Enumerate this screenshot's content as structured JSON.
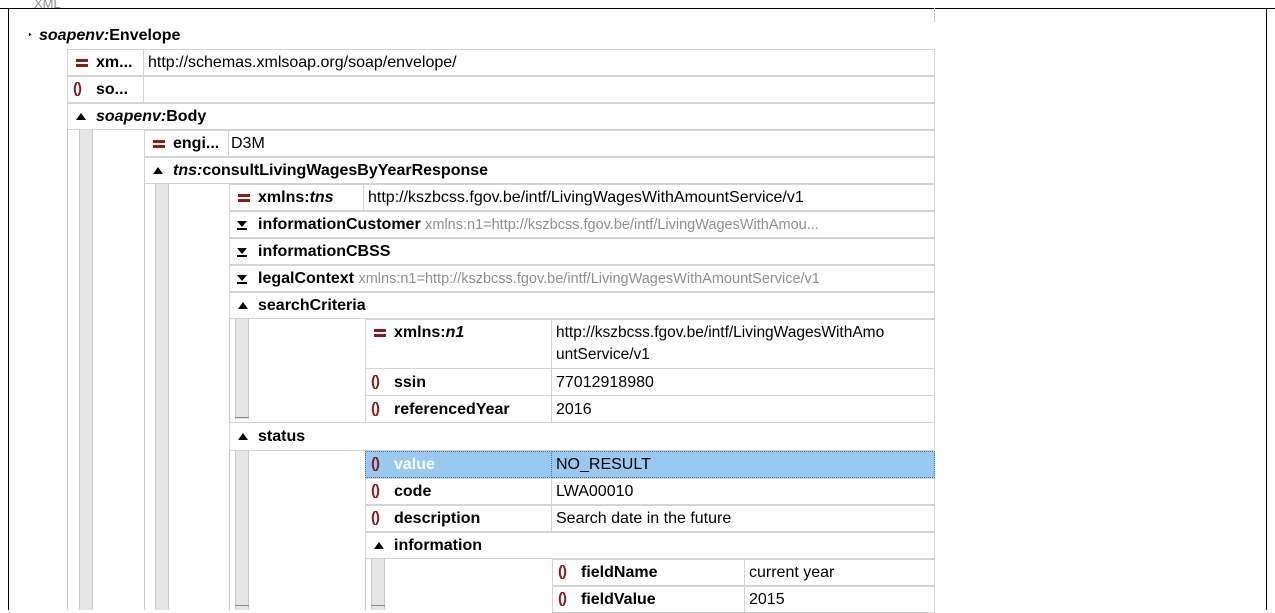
{
  "header": {
    "top_label": "XML"
  },
  "envelope": {
    "name_prefix": "soapenv:",
    "name_local": "Envelope",
    "attr_name": "xm...",
    "attr_value": "http://schemas.xmlsoap.org/soap/envelope/",
    "child_elem_name": "so..."
  },
  "body": {
    "name_prefix": "soapenv:",
    "name_local": "Body",
    "attr_name": "engi...",
    "attr_value": "D3M"
  },
  "response": {
    "name_prefix": "tns:",
    "name_local": "consultLivingWagesByYearResponse",
    "xmlns_name_prefix": "xmlns:",
    "xmlns_name_local": "tns",
    "xmlns_value": "http://kszbcss.fgov.be/intf/LivingWagesWithAmountService/v1",
    "collapsed": [
      {
        "name": "informationCustomer",
        "hint": "xmlns:n1=http://kszbcss.fgov.be/intf/LivingWagesWithAmou..."
      },
      {
        "name": "informationCBSS",
        "hint": ""
      },
      {
        "name": "legalContext",
        "hint": "xmlns:n1=http://kszbcss.fgov.be/intf/LivingWagesWithAmountService/v1"
      }
    ]
  },
  "search": {
    "name": "searchCriteria",
    "xmlns_name_prefix": "xmlns:",
    "xmlns_name_local": "n1",
    "xmlns_value_line1": "http://kszbcss.fgov.be/intf/LivingWagesWithAmo",
    "xmlns_value_line2": "untService/v1",
    "ssin_name": "ssin",
    "ssin_value": "77012918980",
    "year_name": "referencedYear",
    "year_value": "2016"
  },
  "status": {
    "name": "status",
    "value_name": "value",
    "value_value": "NO_RESULT",
    "code_name": "code",
    "code_value": "LWA00010",
    "desc_name": "description",
    "desc_value": "Search date in the future",
    "information": {
      "name": "information",
      "field_name_label": "fieldName",
      "field_name_value": "current year",
      "field_value_label": "fieldValue",
      "field_value_value": "2015"
    }
  },
  "colors": {
    "attr_icon": "#8b1a1a",
    "selection": "#99c9ef",
    "hint_text": "#8f8f8f"
  }
}
